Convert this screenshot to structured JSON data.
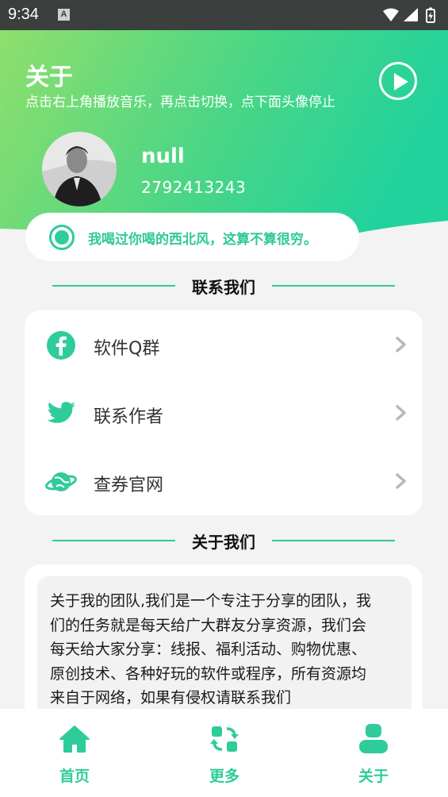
{
  "status_bar": {
    "time": "9:34",
    "notification_badge": "A"
  },
  "header": {
    "title": "关于",
    "subtitle": "点击右上角播放音乐，再点击切换，点下面头像停止",
    "play_icon": "play-circle-icon",
    "gradient_colors": [
      "#8ddf6e",
      "#25d39b"
    ]
  },
  "profile": {
    "name": "null",
    "id": "2792413243"
  },
  "quote": {
    "text": "我喝过你喝的西北风，这算不算很穷。"
  },
  "contact_section": {
    "title": "联系我们",
    "items": [
      {
        "label": "软件Q群",
        "icon": "facebook-icon"
      },
      {
        "label": "联系作者",
        "icon": "twitter-icon"
      },
      {
        "label": "查券官网",
        "icon": "planet-icon"
      }
    ]
  },
  "about_section": {
    "title": "关于我们",
    "lines": [
      "关于我的团队,我们是一个专注于分享的团队，我",
      "们的任务就是每天给广大群友分享资源，我们会",
      "每天给大家分享：线报、福利活动、购物优惠、",
      "原创技术、各种好玩的软件或程序，所有资源均",
      "来自于网络，如果有侵权请联系我们"
    ]
  },
  "bottom_nav": {
    "items": [
      {
        "label": "首页",
        "icon": "home-icon"
      },
      {
        "label": "更多",
        "icon": "swap-icon"
      },
      {
        "label": "关于",
        "icon": "user-icon"
      }
    ]
  },
  "colors": {
    "accent": "#2ecc9a",
    "background": "#f2f3f2",
    "status_bar": "#3b3f3d"
  }
}
